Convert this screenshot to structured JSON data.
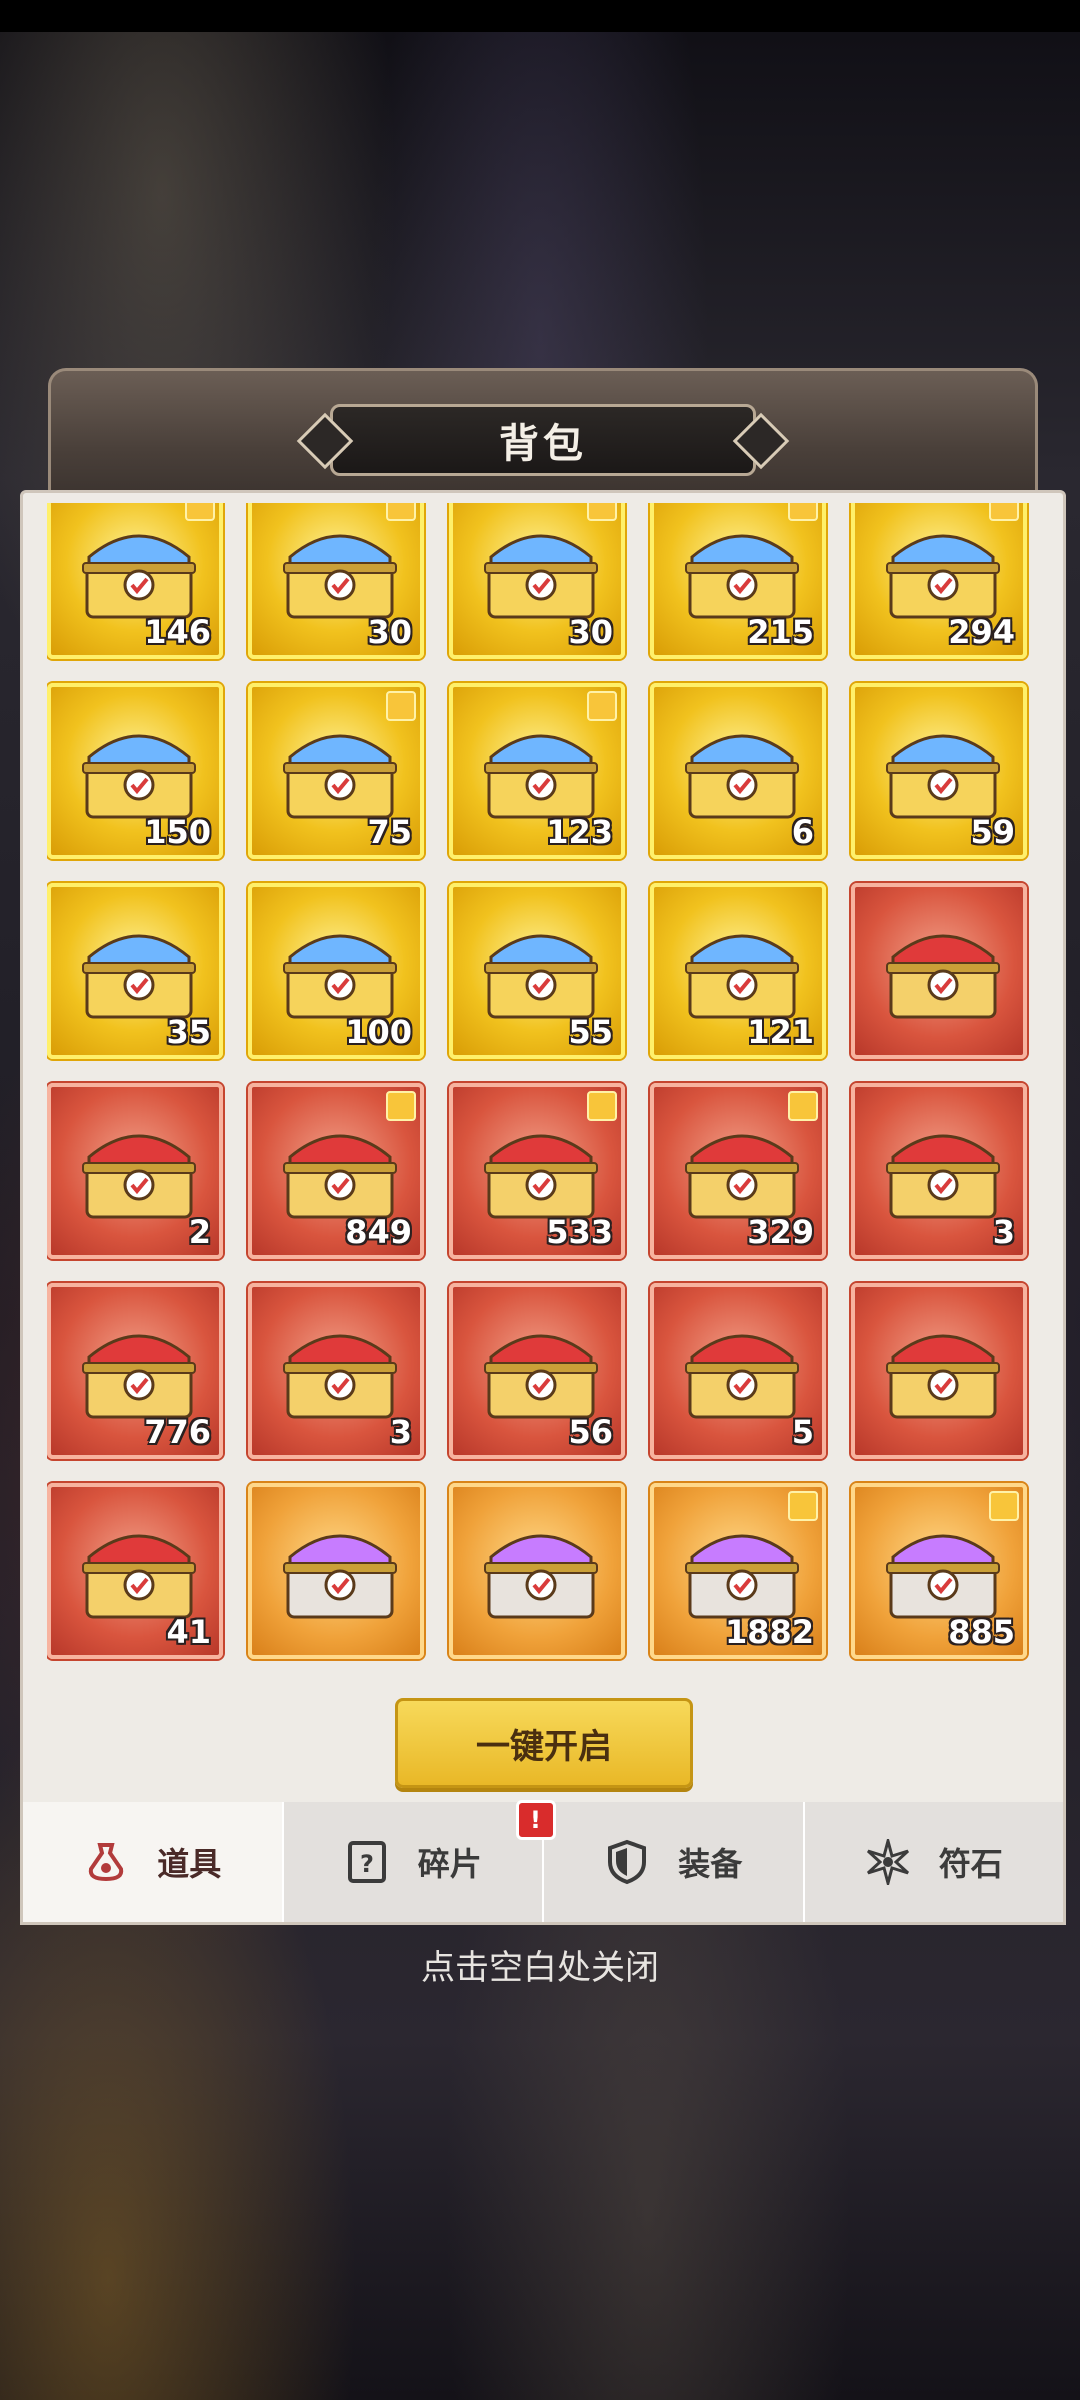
{
  "title": "背包",
  "open_all_label": "一键开启",
  "close_hint": "点击空白处关闭",
  "items": [
    {
      "qty": "146",
      "color": "gold",
      "puzzle": true
    },
    {
      "qty": "30",
      "color": "gold",
      "puzzle": true
    },
    {
      "qty": "30",
      "color": "gold",
      "puzzle": true
    },
    {
      "qty": "215",
      "color": "gold",
      "puzzle": true
    },
    {
      "qty": "294",
      "color": "gold",
      "puzzle": true
    },
    {
      "qty": "150",
      "color": "gold",
      "puzzle": false
    },
    {
      "qty": "75",
      "color": "gold",
      "puzzle": true
    },
    {
      "qty": "123",
      "color": "gold",
      "puzzle": true
    },
    {
      "qty": "6",
      "color": "gold",
      "puzzle": false
    },
    {
      "qty": "59",
      "color": "gold",
      "puzzle": false
    },
    {
      "qty": "35",
      "color": "gold",
      "puzzle": false
    },
    {
      "qty": "100",
      "color": "gold",
      "puzzle": false
    },
    {
      "qty": "55",
      "color": "gold",
      "puzzle": false
    },
    {
      "qty": "121",
      "color": "gold",
      "puzzle": false
    },
    {
      "qty": "",
      "color": "red",
      "puzzle": false
    },
    {
      "qty": "2",
      "color": "red",
      "puzzle": false
    },
    {
      "qty": "849",
      "color": "red",
      "puzzle": true
    },
    {
      "qty": "533",
      "color": "red",
      "puzzle": true
    },
    {
      "qty": "329",
      "color": "red",
      "puzzle": true
    },
    {
      "qty": "3",
      "color": "red",
      "puzzle": false
    },
    {
      "qty": "776",
      "color": "red",
      "puzzle": false
    },
    {
      "qty": "3",
      "color": "red",
      "puzzle": false
    },
    {
      "qty": "56",
      "color": "red",
      "puzzle": false
    },
    {
      "qty": "5",
      "color": "red",
      "puzzle": false
    },
    {
      "qty": "",
      "color": "red",
      "puzzle": false
    },
    {
      "qty": "41",
      "color": "red",
      "puzzle": false
    },
    {
      "qty": "",
      "color": "orange",
      "puzzle": false
    },
    {
      "qty": "",
      "color": "orange",
      "puzzle": false
    },
    {
      "qty": "1882",
      "color": "orange",
      "puzzle": true
    },
    {
      "qty": "885",
      "color": "orange",
      "puzzle": true
    }
  ],
  "tabs": [
    {
      "label": "道具",
      "icon": "potion-icon",
      "active": true
    },
    {
      "label": "碎片",
      "icon": "question-card-icon",
      "active": false,
      "badge": "!"
    },
    {
      "label": "装备",
      "icon": "shield-icon",
      "active": false
    },
    {
      "label": "符石",
      "icon": "rune-star-icon",
      "active": false
    }
  ],
  "colors": {
    "gold_frame": "#f1c21e",
    "red_frame": "#d9553e",
    "orange_frame": "#f0a23a",
    "button": "#f7d95a"
  }
}
